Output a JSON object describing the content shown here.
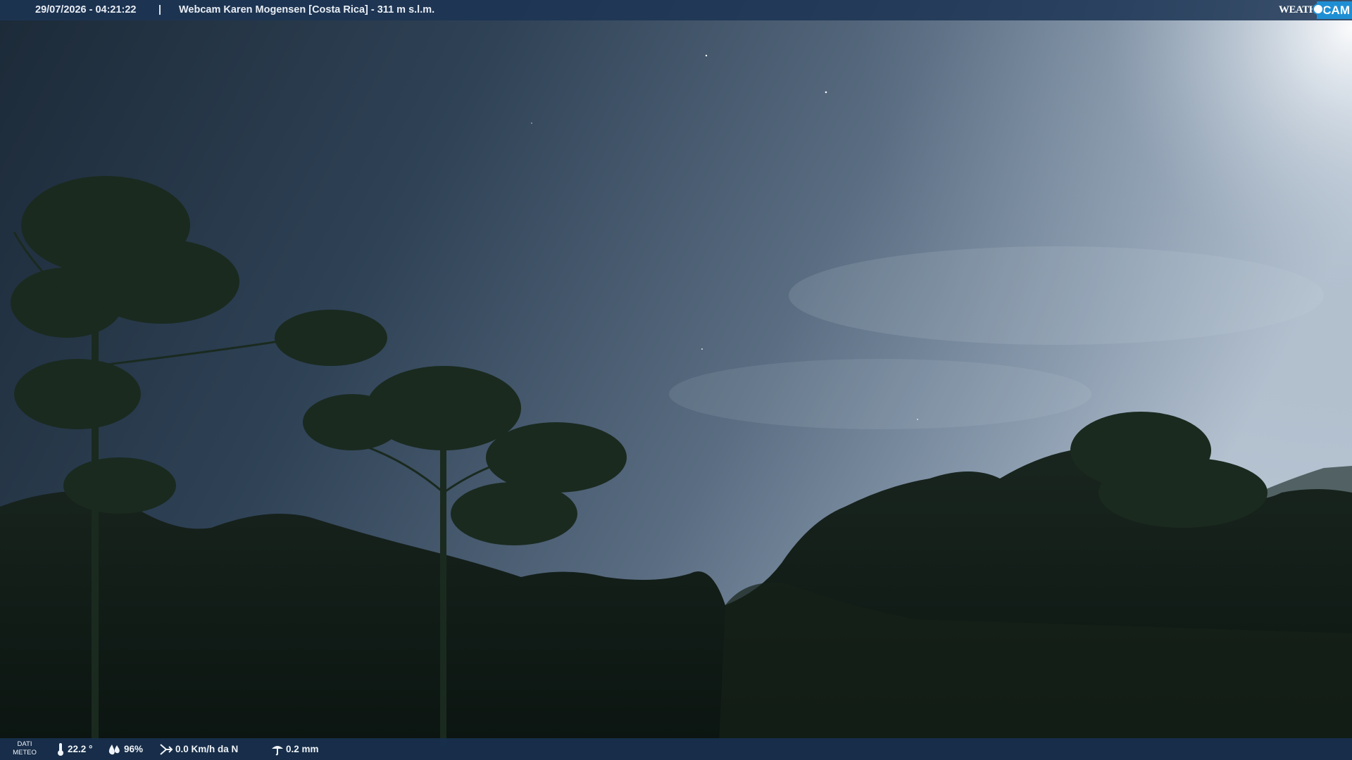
{
  "header": {
    "datetime": "29/07/2026 - 04:21:22",
    "separator": "|",
    "title": "Webcam Karen Mogensen [Costa Rica]  - 311 m s.l.m.",
    "logo": {
      "word1": "WEATHER",
      "word2": "CAM"
    }
  },
  "footer": {
    "badge_line1": "DATI",
    "badge_line2": "METEO",
    "temperature": "22.2 °",
    "humidity": "96%",
    "wind": "0.0 Km/h da N",
    "rain": "0.2 mm"
  },
  "icons": [
    "thermometer-icon",
    "humidity-icon",
    "wind-icon",
    "rain-icon"
  ],
  "colors": {
    "bar": "#1c3454",
    "logo_accent": "#1f8fd4"
  }
}
